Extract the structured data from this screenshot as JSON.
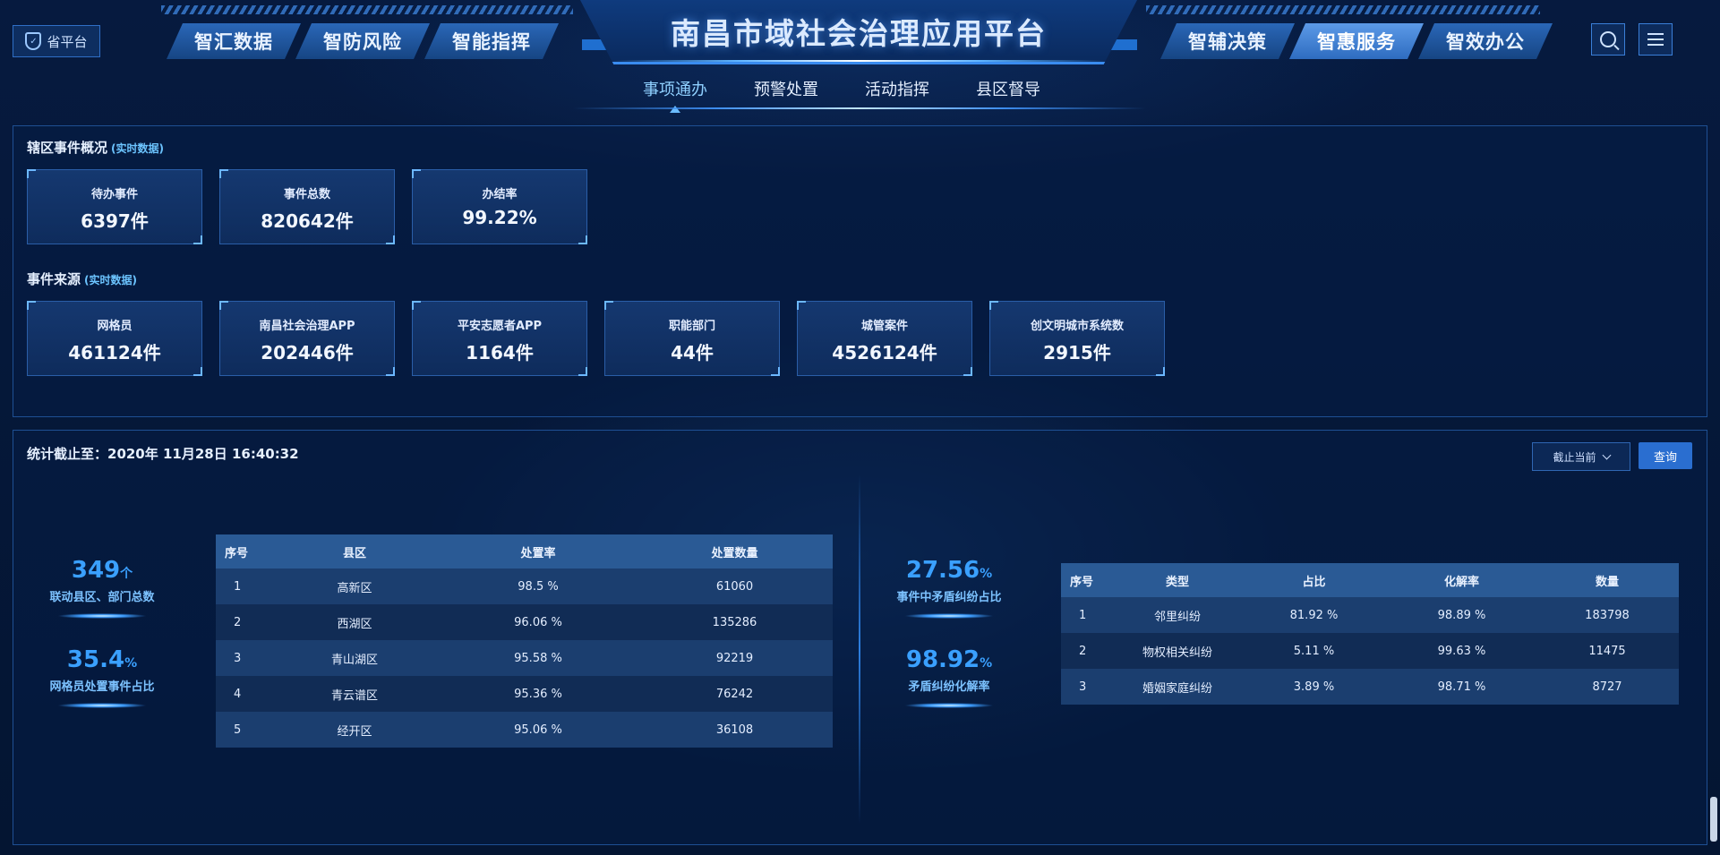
{
  "header": {
    "province_button": "省平台",
    "title": "南昌市域社会治理应用平台",
    "left_tabs": [
      "智汇数据",
      "智防风险",
      "智能指挥"
    ],
    "right_tabs": [
      "智辅决策",
      "智惠服务",
      "智效办公"
    ],
    "active_right_tab": "智惠服务",
    "icons": [
      "search-icon",
      "list-icon"
    ],
    "subnav": [
      "事项通办",
      "预警处置",
      "活动指挥",
      "县区督导"
    ],
    "active_subnav": "事项通办"
  },
  "overview": {
    "title": "辖区事件概况",
    "tag": "(实时数据)",
    "cards": [
      {
        "label": "待办事件",
        "value": "6397件"
      },
      {
        "label": "事件总数",
        "value": "820642件"
      },
      {
        "label": "办结率",
        "value": "99.22%"
      }
    ]
  },
  "sources": {
    "title": "事件来源",
    "tag": "(实时数据)",
    "cards": [
      {
        "label": "网格员",
        "value": "461124件"
      },
      {
        "label": "南昌社会治理APP",
        "value": "202446件"
      },
      {
        "label": "平安志愿者APP",
        "value": "1164件"
      },
      {
        "label": "职能部门",
        "value": "44件"
      },
      {
        "label": "城管案件",
        "value": "4526124件"
      },
      {
        "label": "创文明城市系统数",
        "value": "2915件"
      }
    ]
  },
  "stats": {
    "deadline": "统计截止至：2020年 11月28日 16:40:32",
    "range_select": "截止当前",
    "query_button": "查询",
    "left_kpis": [
      {
        "value": "349",
        "unit": "个",
        "label": "联动县区、部门总数"
      },
      {
        "value": "35.4",
        "unit": "%",
        "label": "网格员处置事件占比"
      }
    ],
    "right_kpis": [
      {
        "value": "27.56",
        "unit": "%",
        "label": "事件中矛盾纠纷占比"
      },
      {
        "value": "98.92",
        "unit": "%",
        "label": "矛盾纠纷化解率"
      }
    ],
    "district_table": {
      "headers": [
        "序号",
        "县区",
        "处置率",
        "处置数量"
      ],
      "rows": [
        [
          "1",
          "高新区",
          "98.5 %",
          "61060"
        ],
        [
          "2",
          "西湖区",
          "96.06 %",
          "135286"
        ],
        [
          "3",
          "青山湖区",
          "95.58 %",
          "92219"
        ],
        [
          "4",
          "青云谱区",
          "95.36 %",
          "76242"
        ],
        [
          "5",
          "经开区",
          "95.06 %",
          "36108"
        ]
      ]
    },
    "dispute_table": {
      "headers": [
        "序号",
        "类型",
        "占比",
        "化解率",
        "数量"
      ],
      "rows": [
        [
          "1",
          "邻里纠纷",
          "81.92 %",
          "98.89 %",
          "183798"
        ],
        [
          "2",
          "物权相关纠纷",
          "5.11 %",
          "99.63 %",
          "11475"
        ],
        [
          "3",
          "婚姻家庭纠纷",
          "3.89 %",
          "98.71 %",
          "8727"
        ]
      ]
    }
  }
}
